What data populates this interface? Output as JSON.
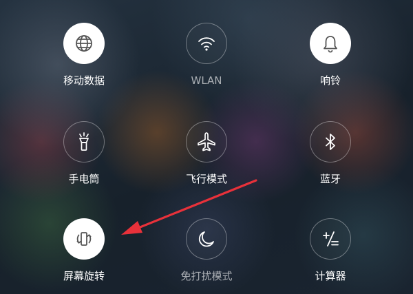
{
  "tiles": [
    {
      "label": "移动数据",
      "icon": "globe-icon",
      "active": true
    },
    {
      "label": "WLAN",
      "icon": "wifi-icon",
      "active": false
    },
    {
      "label": "响铃",
      "icon": "bell-icon",
      "active": true
    },
    {
      "label": "手电筒",
      "icon": "flashlight-icon",
      "active": false
    },
    {
      "label": "飞行模式",
      "icon": "airplane-icon",
      "active": false
    },
    {
      "label": "蓝牙",
      "icon": "bluetooth-icon",
      "active": false
    },
    {
      "label": "屏幕旋转",
      "icon": "screen-rotation-icon",
      "active": true
    },
    {
      "label": "免打扰模式",
      "icon": "moon-icon",
      "active": false
    },
    {
      "label": "计算器",
      "icon": "calculator-icon",
      "active": false
    }
  ],
  "colors": {
    "active_fill": "#ffffff",
    "active_icon": "#555555",
    "inactive_icon": "#ffffff",
    "annotation_arrow": "#e8313a"
  }
}
